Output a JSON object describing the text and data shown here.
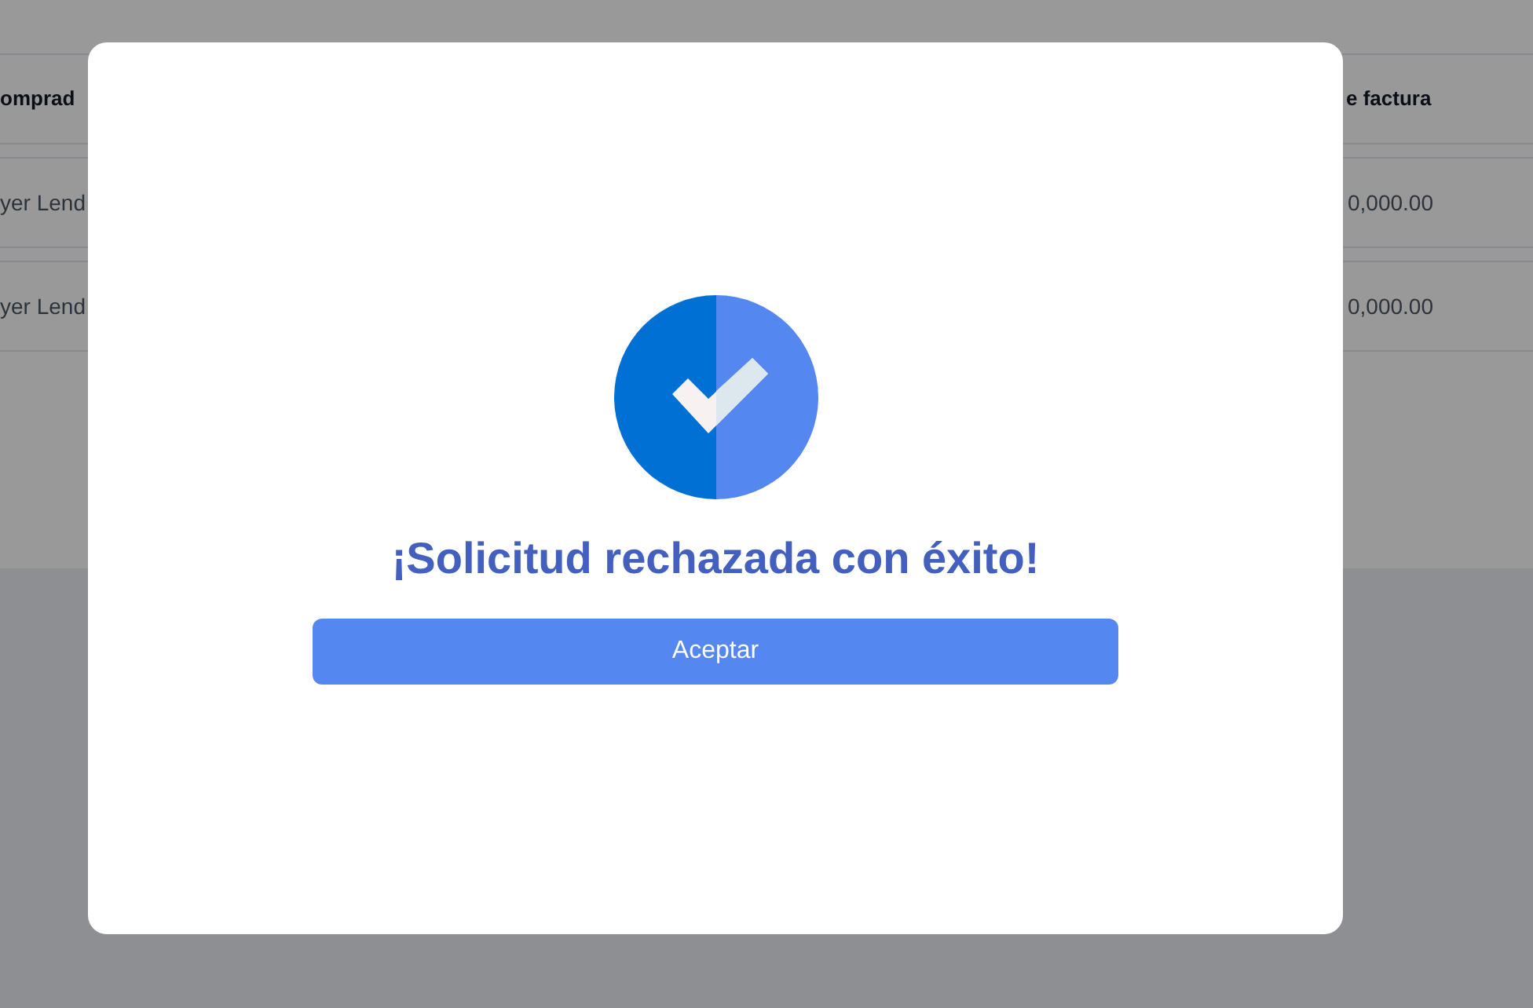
{
  "table": {
    "columns": [
      "omprad",
      "e factura"
    ],
    "rows": [
      [
        "yer Lend",
        "0,000.00"
      ],
      [
        "yer Lend",
        "0,000.00"
      ]
    ]
  },
  "modal": {
    "title": "¡Solicitud rechazada con éxito!",
    "button": "Aceptar"
  }
}
